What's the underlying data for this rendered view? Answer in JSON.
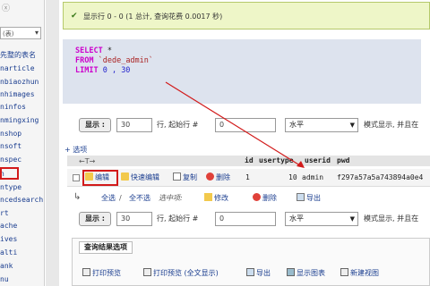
{
  "sidebar": {
    "top_icon": "ⓧ",
    "select_value": "(表)",
    "items": [
      "先整的表名",
      "narticle",
      "nbiaozhun",
      "nhimages",
      "ninfos",
      "nmingxing",
      "nshop",
      "nsoft",
      "nspec",
      "n",
      "ntype",
      "ncedsearch",
      "rt",
      "ache",
      "ives",
      "alti",
      "ank",
      "nu"
    ]
  },
  "notice": {
    "icon": "check-icon",
    "text": "显示行 0 - 0 (1 总计, 查询花费 0.0017 秒)"
  },
  "sql": {
    "select_kw": "SELECT",
    "select_rest": " *",
    "from_kw": "FROM",
    "from_table": "`dede_admin`",
    "limit_kw": "LIMIT",
    "limit_vals": "0 , 30"
  },
  "controls": {
    "show_button": "显示 :",
    "rows_value": "30",
    "rows_label": "行, 起始行 #",
    "start_value": "0",
    "direction_value": "水平",
    "mode_text": "模式显示, 并且在"
  },
  "options_link": "+ 选项",
  "columns": [
    "id",
    "usertype",
    "userid",
    "pwd"
  ],
  "row": {
    "edit": "编辑",
    "quick_edit": "快速编辑",
    "copy": "复制",
    "delete": "删除",
    "id": "1",
    "usertype": "10",
    "userid": "admin",
    "pwd": "f297a57a5a743894a0e4"
  },
  "bulk": {
    "select_all": "全选",
    "unselect_all": "全不选",
    "selected_label": "选中项:",
    "modify": "修改",
    "delete": "删除",
    "export": "导出"
  },
  "results_ops": {
    "legend": "查询结果选项",
    "print": "打印预览",
    "print_full": "打印预览 (全文显示)",
    "export": "导出",
    "chart": "显示图表",
    "create_view": "新建视图"
  },
  "colors": {
    "highlight": "#d21a1a",
    "notice_bg": "#eef6c8",
    "sql_bg": "#dde3ee",
    "link": "#1a3d8f"
  }
}
